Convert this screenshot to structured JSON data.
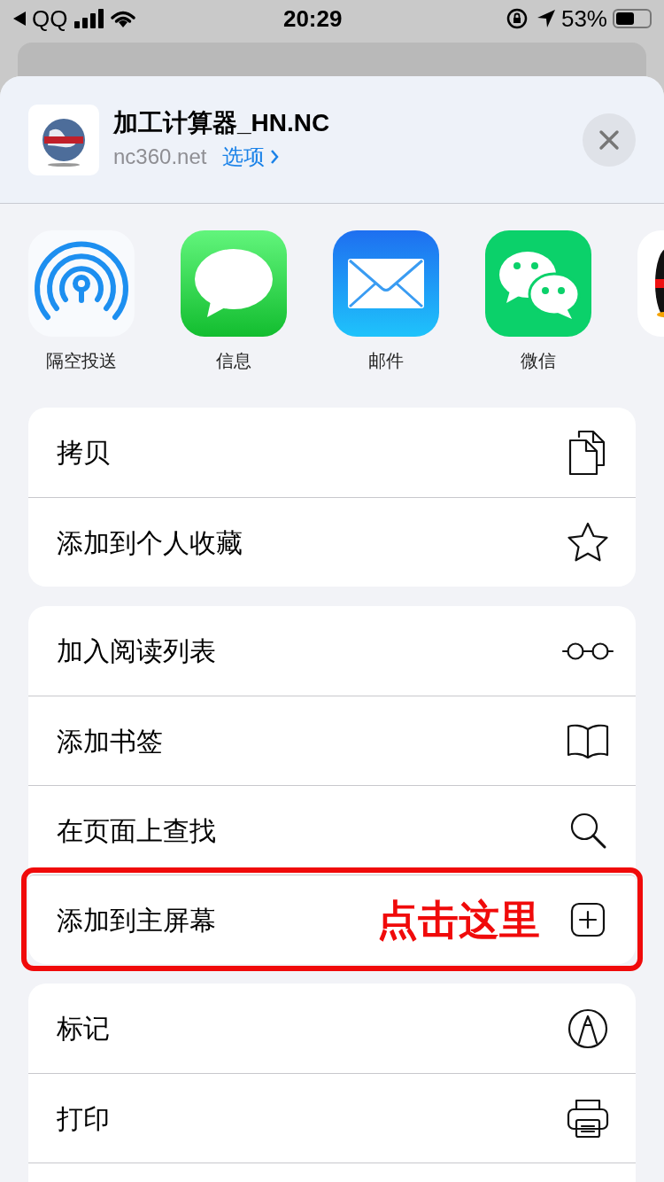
{
  "status_bar": {
    "back_label": "QQ",
    "time": "20:29",
    "battery": "53%"
  },
  "header": {
    "title": "加工计算器_HN.NC",
    "subtitle": "nc360.net",
    "options": "选项"
  },
  "apps": [
    {
      "kind": "airdrop",
      "label": "隔空投送"
    },
    {
      "kind": "messages",
      "label": "信息"
    },
    {
      "kind": "mail",
      "label": "邮件"
    },
    {
      "kind": "wechat",
      "label": "微信"
    },
    {
      "kind": "qq"
    }
  ],
  "groups": [
    {
      "rows": [
        {
          "label": "拷贝",
          "kind": "copy",
          "highlighted": false
        },
        {
          "label": "添加到个人收藏",
          "kind": "star",
          "highlighted": false
        }
      ]
    },
    {
      "rows": [
        {
          "label": "加入阅读列表",
          "kind": "glasses",
          "highlighted": false
        },
        {
          "label": "添加书签",
          "kind": "book",
          "highlighted": false
        },
        {
          "label": "在页面上查找",
          "kind": "search",
          "highlighted": false
        },
        {
          "label": "添加到主屏幕",
          "kind": "plus",
          "highlighted": true,
          "annotation": "点击这里"
        }
      ]
    },
    {
      "rows": [
        {
          "label": "标记",
          "kind": "markup",
          "highlighted": false
        },
        {
          "label": "打印",
          "kind": "print",
          "highlighted": false
        },
        {
          "kind": "blank"
        }
      ]
    }
  ]
}
